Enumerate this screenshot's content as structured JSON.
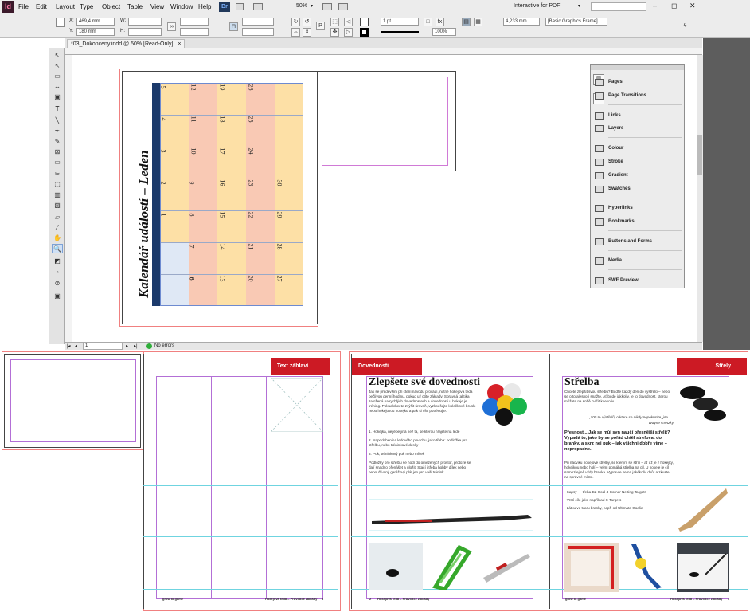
{
  "app": {
    "logo": "Id"
  },
  "menubar": {
    "items": [
      "File",
      "Edit",
      "Layout",
      "Type",
      "Object",
      "Table",
      "View",
      "Window",
      "Help"
    ],
    "bridge_label": "Br",
    "zoom": "50%",
    "workspace": "Interactive for PDF",
    "search_placeholder": ""
  },
  "control": {
    "x_label": "X:",
    "x_value": "469,4 mm",
    "y_label": "Y:",
    "y_value": "180 mm",
    "w_label": "W:",
    "h_label": "H:",
    "stroke_weight": "1 pt",
    "scale_value": "100%",
    "dimension_value": "4,233 mm",
    "object_style": "[Basic Graphics Frame]"
  },
  "document": {
    "tab_title": "*03_Dokonceny.indd @ 50% [Read-Only]",
    "tab_close": "×"
  },
  "status": {
    "page": "1",
    "preflight": "No errors"
  },
  "calendar": {
    "title": "Kalendář událostí – Leden",
    "week_numbers": [
      "5",
      "4",
      "3",
      "2",
      "1",
      "6"
    ],
    "rows": [
      [
        "12",
        "19",
        "26"
      ],
      [
        "11",
        "18",
        "25"
      ],
      [
        "10",
        "17",
        "24"
      ],
      [
        "9",
        "16",
        "23",
        "30"
      ],
      [
        "8",
        "15",
        "22",
        "29"
      ],
      [
        "7",
        "14",
        "21",
        "28"
      ],
      [
        "6",
        "13",
        "20",
        "27"
      ]
    ]
  },
  "panel": {
    "items": [
      "Pages",
      "Page Transitions",
      "Links",
      "Layers",
      "Colour",
      "Stroke",
      "Gradient",
      "Swatches",
      "Hyperlinks",
      "Bookmarks",
      "Buttons and Forms",
      "Media",
      "SWF Preview"
    ]
  },
  "spread": {
    "header_left_label": "Text záhlaví",
    "section_skills": "Dovednosti",
    "section_shots": "Střely",
    "skills_title": "Zlepšete své dovednosti",
    "shots_title": "Střelba",
    "skills_text": "Jak se především při čtení návodu provádí, nutné hokejová teda pečlivou denní hodinu, pokud už ctíte základy. Správná taktika založená na rychlých dovednostech a dovednosti u hokeje je tréning. Pokud chcete zvýšit úroveň, vyzkoušejte kolečkové brusle nebo hokejovou hokejku a pak si vše potrénujte.",
    "skills_list": [
      "1. Hokejka, nejlépe jiná než ta, se kterou hrajete na ledě",
      "2. Napodobenina ledového povrchu, jako třeba: podložka pro střelbu, nebo tréninkové desky",
      "3. Puk, tréninkový puk nebo míček"
    ],
    "skills_text2": "Podložky pro střelbu se hodí do omezených prostor, protože se dají snadno přenášet a uložit. Stačí i třeba hobby dílek nebo nepoužívaný garážový plát jen pro vaši trénink.",
    "shots_text": "Chcete zlepšit svou střelbu? Buďte každý den do výstřelů – nebo se o to alespoň snažte. Ať bude jakkoliv, je to dovednost, kterou můžete na sobě cvičit kdekoliv.",
    "shots_quote": "„100 % výstřelů, o které se nikdy nepokusíte, jde mimo.“",
    "shots_quote_author": "Wayne Gretzky",
    "shots_subhead": "Přesnost... Jak se můj syn naučí přesnější střelit? Vypadá to, jako by se pořád chtěl strefovat do branky, a skrz nej puk – jak všichni dobře víme – nepropadne.",
    "shots_text2": "Při nácviku hokejové střelby, se kterým se střílí – ať už je z hokejky, hokejkou nebo holí – velmi pomáhá střelba na cíl. U hokeje je cíl samozřejmě vždy branka. Vypravte se na jakékoliv dvůr a zkuste na správné místo.",
    "shots_list": [
      "- Kapsy — třeba EZ Goal 4-Corner Netting Targets",
      "- Vrstí cíle jako například X-Targets",
      "- Látku ve tvaru branky, např. od Ultimate Goalie"
    ],
    "footer_brand": "grow to game",
    "footer_text": "Hokejová teda – Průvodce základy",
    "footer_page_left": "2",
    "footer_page_right": "3"
  },
  "colors": {
    "accent_red": "#cc1a24",
    "calendar_orange": "#fde0a6",
    "calendar_pink": "#f9c9b4",
    "calendar_blue": "#1b3a6b"
  }
}
